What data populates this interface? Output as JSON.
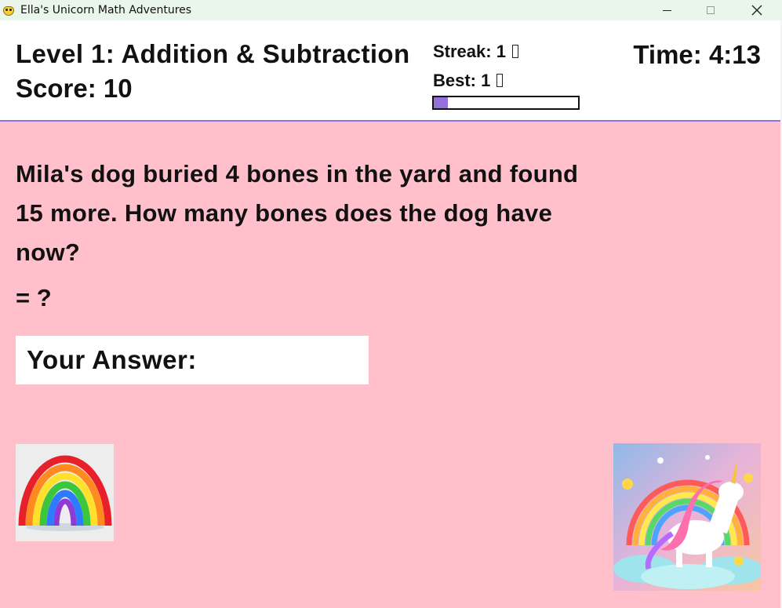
{
  "window": {
    "title": "Ella's Unicorn Math Adventures",
    "icon": "pygame-snake-icon"
  },
  "header": {
    "level_title": "Level 1: Addition & Subtraction",
    "score": "Score: 10",
    "streak": "Streak: 1",
    "best": "Best: 1",
    "streak_progress_fraction": 0.1,
    "timer": "Time: 4:13"
  },
  "question": {
    "text": "Mila's dog buried 4 bones in the yard and found 15 more. How many bones does the dog have now?",
    "equation": "= ?"
  },
  "answer": {
    "label": "Your Answer:",
    "value": ""
  },
  "images": {
    "left": "rainbow-image",
    "right": "unicorn-image"
  },
  "colors": {
    "background": "#ffc0cb",
    "header_bg": "#ffffff",
    "accent": "#9370db",
    "text": "#111111"
  }
}
